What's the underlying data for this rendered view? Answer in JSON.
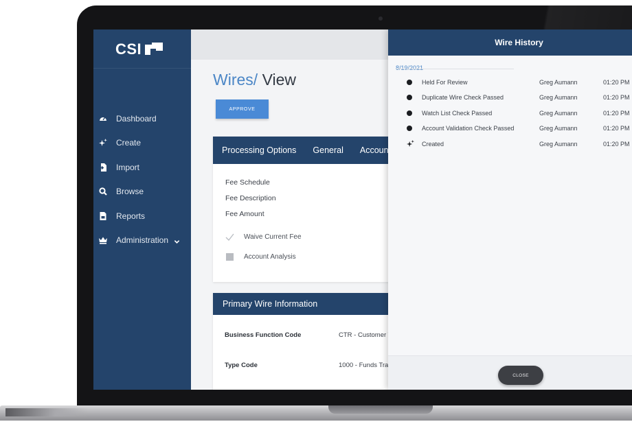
{
  "app": {
    "logo_text": "CSI"
  },
  "sidebar": {
    "items": [
      {
        "label": "Dashboard",
        "icon": "dashboard-icon"
      },
      {
        "label": "Create",
        "icon": "sparkle-icon"
      },
      {
        "label": "Import",
        "icon": "import-icon"
      },
      {
        "label": "Browse",
        "icon": "search-icon"
      },
      {
        "label": "Reports",
        "icon": "report-icon"
      },
      {
        "label": "Administration",
        "icon": "crown-icon",
        "has_submenu": true
      }
    ]
  },
  "page": {
    "breadcrumb": "Wires/",
    "title": "View",
    "approve_label": "APPROVE"
  },
  "processing_card": {
    "tabs": [
      "Processing Options",
      "General",
      "Account"
    ],
    "fields": [
      "Fee Schedule",
      "Fee Description",
      "Fee Amount"
    ],
    "waive_label": "Waive Current Fee",
    "waive_checked": true,
    "analysis_label": "Account Analysis",
    "analysis_checked": false
  },
  "wire_info_card": {
    "title": "Primary Wire Information",
    "rows": [
      {
        "label": "Business Function Code",
        "value": "CTR - Customer T"
      },
      {
        "label": "Type Code",
        "value": "1000 - Funds Tra"
      }
    ]
  },
  "wire_history": {
    "title": "Wire History",
    "date": "8/19/2021",
    "events": [
      {
        "label": "Held For Review",
        "user": "Greg Aumann",
        "time": "01:20 PM",
        "icon": "dot-icon"
      },
      {
        "label": "Duplicate Wire Check Passed",
        "user": "Greg Aumann",
        "time": "01:20 PM",
        "icon": "dot-icon"
      },
      {
        "label": "Watch List Check Passed",
        "user": "Greg Aumann",
        "time": "01:20 PM",
        "icon": "dot-icon"
      },
      {
        "label": "Account Validation Check Passed",
        "user": "Greg Aumann",
        "time": "01:20 PM",
        "icon": "dot-icon"
      },
      {
        "label": "Created",
        "user": "Greg Aumann",
        "time": "01:20 PM",
        "icon": "sparkle-icon"
      }
    ],
    "close_label": "CLOSE"
  },
  "colors": {
    "sidebar": "#24446b",
    "accent": "#4a8ad6",
    "breadcrumb": "#4b86c6"
  }
}
